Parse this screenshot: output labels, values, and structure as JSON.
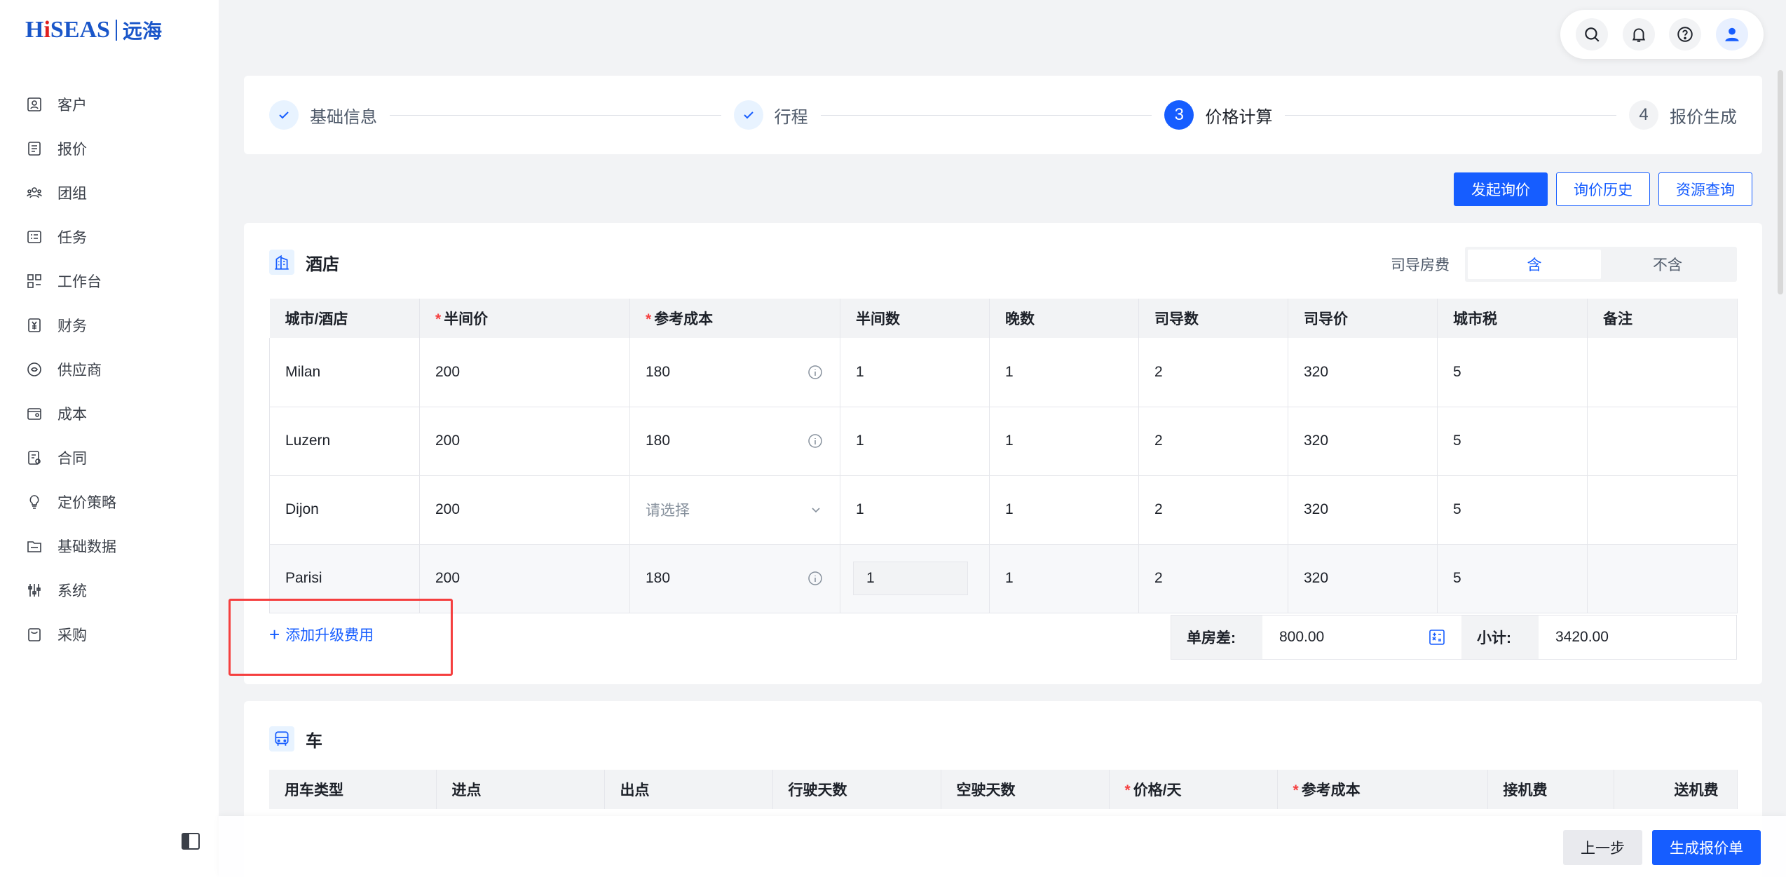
{
  "brand": {
    "name_en_pre": "H",
    "name_en_i": "i",
    "name_en_post": "SEAS",
    "name_cn": "远海",
    "color": "#1a56c9"
  },
  "sidebar": {
    "items": [
      {
        "label": "客户",
        "icon": "customer-icon"
      },
      {
        "label": "报价",
        "icon": "quote-icon"
      },
      {
        "label": "团组",
        "icon": "group-icon"
      },
      {
        "label": "任务",
        "icon": "task-icon"
      },
      {
        "label": "工作台",
        "icon": "workbench-icon"
      },
      {
        "label": "财务",
        "icon": "finance-icon"
      },
      {
        "label": "供应商",
        "icon": "supplier-icon"
      },
      {
        "label": "成本",
        "icon": "cost-icon"
      },
      {
        "label": "合同",
        "icon": "contract-icon"
      },
      {
        "label": "定价策略",
        "icon": "pricing-strategy-icon"
      },
      {
        "label": "基础数据",
        "icon": "base-data-icon"
      },
      {
        "label": "系统",
        "icon": "system-icon"
      },
      {
        "label": "采购",
        "icon": "purchase-icon"
      }
    ]
  },
  "steps": [
    {
      "label": "基础信息",
      "state": "done",
      "num": ""
    },
    {
      "label": "行程",
      "state": "done",
      "num": ""
    },
    {
      "label": "价格计算",
      "state": "active",
      "num": "3"
    },
    {
      "label": "报价生成",
      "state": "todo",
      "num": "4"
    }
  ],
  "actions": {
    "start_inquiry": "发起询价",
    "inquiry_history": "询价历史",
    "resource_query": "资源查询"
  },
  "hotel": {
    "title": "酒店",
    "driver_room_label": "司导房费",
    "seg_include": "含",
    "seg_exclude": "不含",
    "columns": [
      "城市/酒店",
      "半间价",
      "参考成本",
      "半间数",
      "晚数",
      "司导数",
      "司导价",
      "城市税",
      "备注"
    ],
    "rows": [
      {
        "city": "Milan",
        "half_price": "200",
        "ref_cost": "180",
        "half_rooms": "1",
        "nights": "1",
        "drivers": "2",
        "driver_price": "320",
        "city_tax": "5",
        "note": ""
      },
      {
        "city": "Luzern",
        "half_price": "200",
        "ref_cost": "180",
        "half_rooms": "1",
        "nights": "1",
        "drivers": "2",
        "driver_price": "320",
        "city_tax": "5",
        "note": ""
      },
      {
        "city": "Dijon",
        "half_price": "200",
        "ref_cost": "",
        "ref_cost_placeholder": "请选择",
        "half_rooms": "1",
        "nights": "1",
        "drivers": "2",
        "driver_price": "320",
        "city_tax": "5",
        "note": ""
      },
      {
        "city": "Parisi",
        "half_price": "200",
        "ref_cost": "180",
        "half_rooms": "1",
        "nights": "1",
        "drivers": "2",
        "driver_price": "320",
        "city_tax": "5",
        "note": ""
      }
    ],
    "add_upgrade": "添加升级费用",
    "single_room_diff_label": "单房差:",
    "single_room_diff": "800.00",
    "subtotal_label": "小计:",
    "subtotal": "3420.00"
  },
  "car": {
    "title": "车",
    "columns": [
      "用车类型",
      "进点",
      "出点",
      "行驶天数",
      "空驶天数",
      "价格/天",
      "参考成本",
      "接机费",
      "送机费"
    ]
  },
  "bottom": {
    "prev": "上一步",
    "generate": "生成报价单"
  },
  "colors": {
    "primary": "#165dff",
    "required": "#f53f3f",
    "highlight_box": "#f53f3f"
  }
}
